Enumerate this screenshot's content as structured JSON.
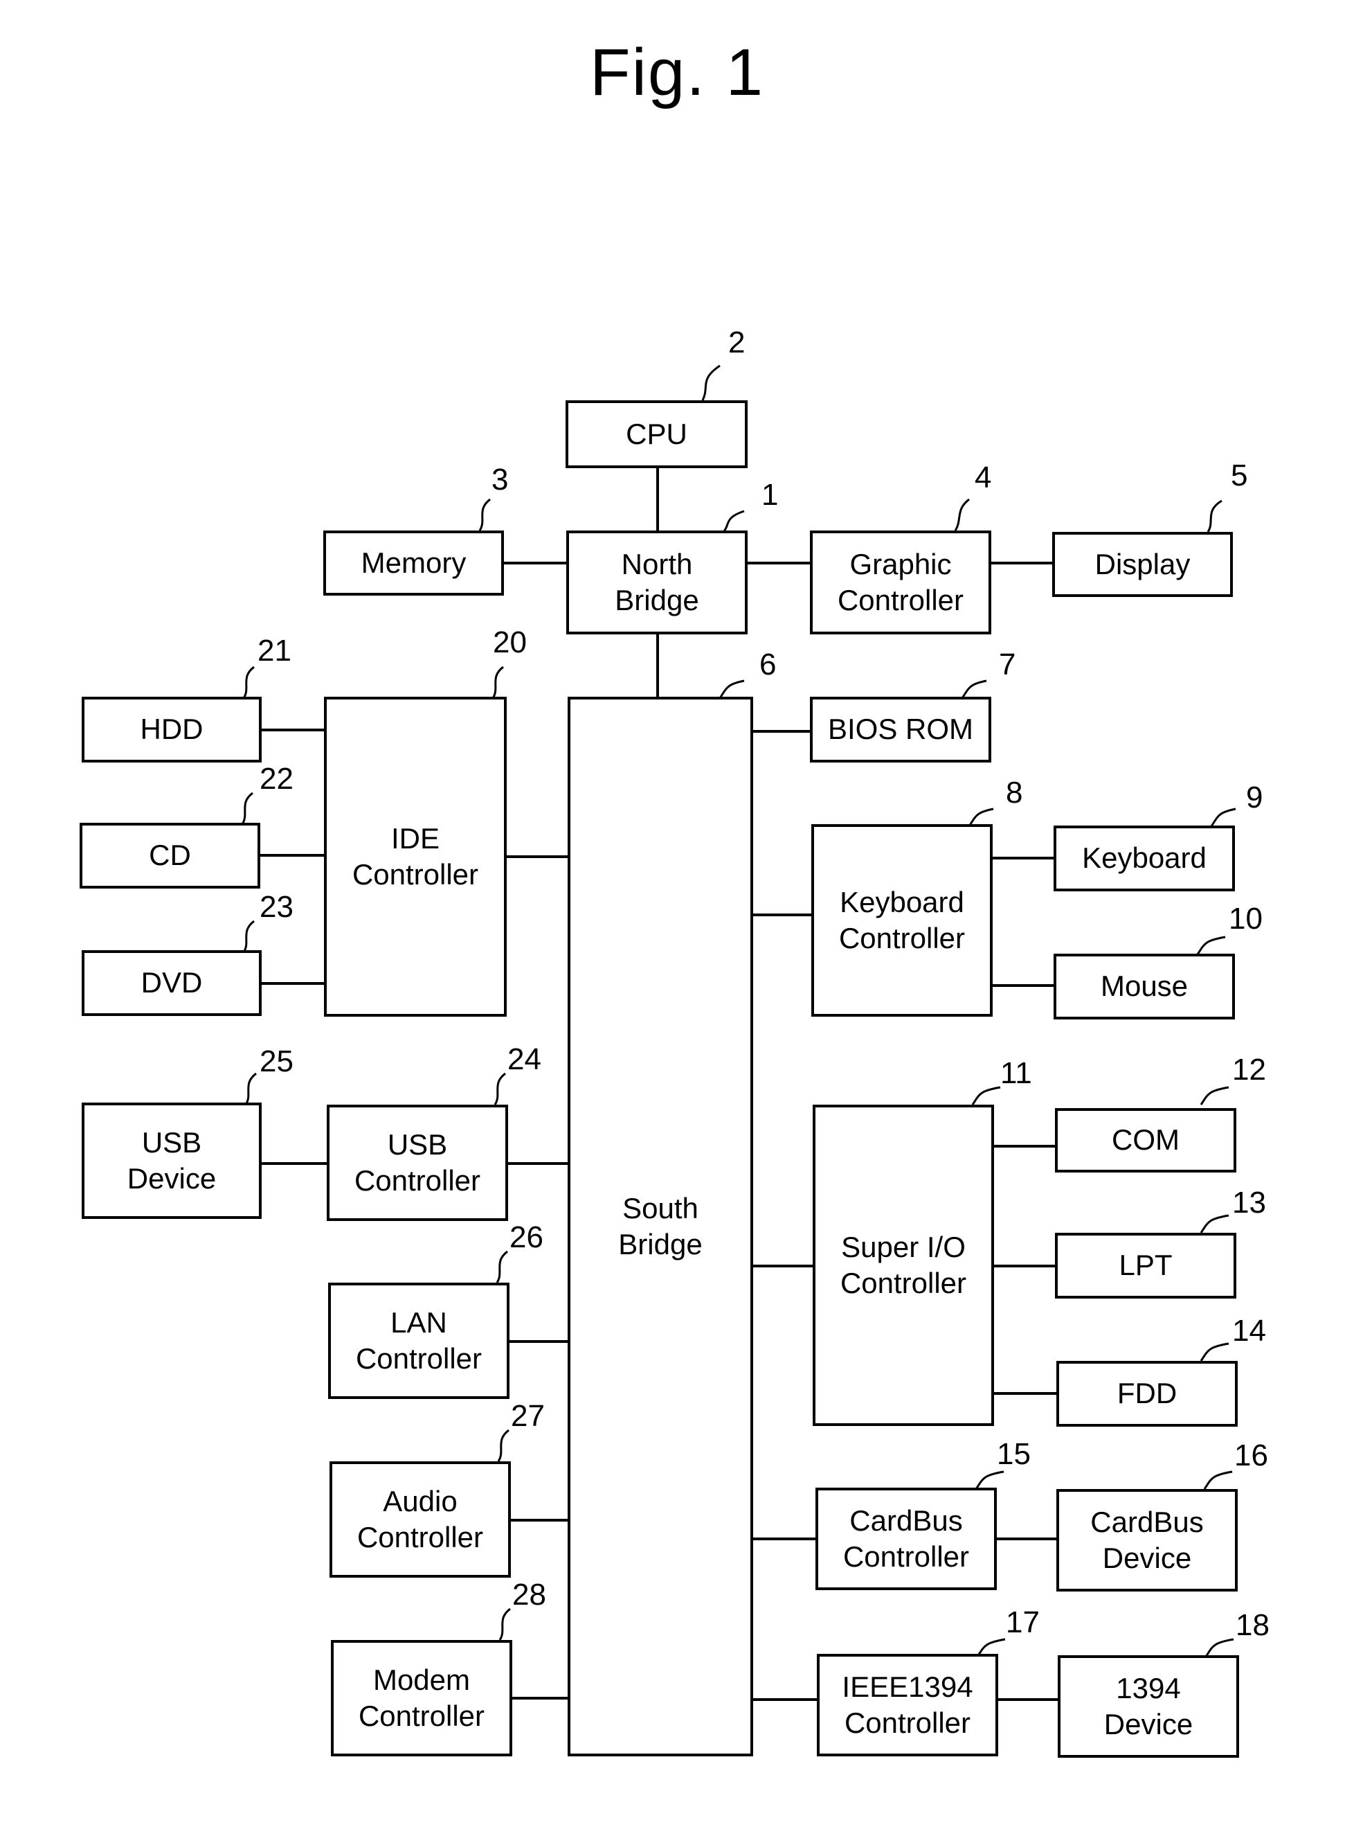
{
  "title": "Fig. 1",
  "blocks": {
    "cpu": {
      "label": "CPU",
      "ref": "2"
    },
    "north_bridge": {
      "label": "North\nBridge",
      "ref": "1"
    },
    "memory": {
      "label": "Memory",
      "ref": "3"
    },
    "graphic_controller": {
      "label": "Graphic\nController",
      "ref": "4"
    },
    "display": {
      "label": "Display",
      "ref": "5"
    },
    "south_bridge": {
      "label": "South\nBridge",
      "ref": "6"
    },
    "bios_rom": {
      "label": "BIOS ROM",
      "ref": "7"
    },
    "keyboard_controller": {
      "label": "Keyboard\nController",
      "ref": "8"
    },
    "keyboard": {
      "label": "Keyboard",
      "ref": "9"
    },
    "mouse": {
      "label": "Mouse",
      "ref": "10"
    },
    "super_io_controller": {
      "label": "Super I/O\nController",
      "ref": "11"
    },
    "com": {
      "label": "COM",
      "ref": "12"
    },
    "lpt": {
      "label": "LPT",
      "ref": "13"
    },
    "fdd": {
      "label": "FDD",
      "ref": "14"
    },
    "cardbus_controller": {
      "label": "CardBus\nController",
      "ref": "15"
    },
    "cardbus_device": {
      "label": "CardBus\nDevice",
      "ref": "16"
    },
    "ieee1394_controller": {
      "label": "IEEE1394\nController",
      "ref": "17"
    },
    "device_1394": {
      "label": "1394\nDevice",
      "ref": "18"
    },
    "ide_controller": {
      "label": "IDE\nController",
      "ref": "20"
    },
    "hdd": {
      "label": "HDD",
      "ref": "21"
    },
    "cd": {
      "label": "CD",
      "ref": "22"
    },
    "dvd": {
      "label": "DVD",
      "ref": "23"
    },
    "usb_controller": {
      "label": "USB\nController",
      "ref": "24"
    },
    "usb_device": {
      "label": "USB\nDevice",
      "ref": "25"
    },
    "lan_controller": {
      "label": "LAN\nController",
      "ref": "26"
    },
    "audio_controller": {
      "label": "Audio\nController",
      "ref": "27"
    },
    "modem_controller": {
      "label": "Modem\nController",
      "ref": "28"
    }
  }
}
